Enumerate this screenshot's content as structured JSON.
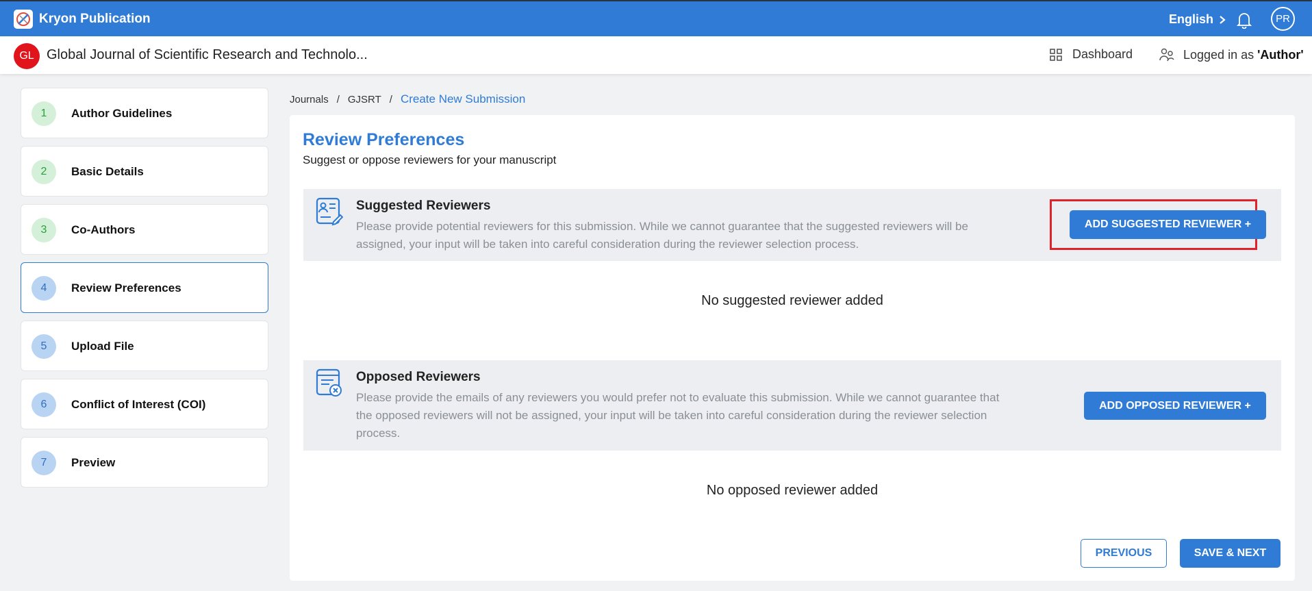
{
  "app": {
    "title": "Kryon Publication",
    "accent": "#2f7bd6"
  },
  "header": {
    "language": "English",
    "avatar_initials": "PR"
  },
  "journal": {
    "badge": "GL",
    "title": "Global Journal of Scientific Research and Technolo...",
    "dashboard_label": "Dashboard",
    "logged_prefix": "Logged in as",
    "logged_role": "'Author'"
  },
  "steps": [
    {
      "num": "1",
      "label": "Author Guidelines"
    },
    {
      "num": "2",
      "label": "Basic Details"
    },
    {
      "num": "3",
      "label": "Co-Authors"
    },
    {
      "num": "4",
      "label": "Review Preferences"
    },
    {
      "num": "5",
      "label": "Upload File"
    },
    {
      "num": "6",
      "label": "Conflict of Interest (COI)"
    },
    {
      "num": "7",
      "label": "Preview"
    }
  ],
  "breadcrumb": {
    "journals": "Journals",
    "sep": "/",
    "journal_code": "GJSRT",
    "current": "Create New Submission"
  },
  "page": {
    "title": "Review Preferences",
    "subtitle": "Suggest or oppose reviewers for your manuscript"
  },
  "suggested": {
    "title": "Suggested Reviewers",
    "description": "Please provide potential reviewers for this submission. While we cannot guarantee that the suggested reviewers will be assigned, your input will be taken into careful consideration during the reviewer selection process.",
    "button": "ADD SUGGESTED REVIEWER +",
    "empty": "No suggested reviewer added"
  },
  "opposed": {
    "title": "Opposed Reviewers",
    "description": "Please provide the emails of any reviewers you would prefer not to evaluate this submission. While we cannot guarantee that the opposed reviewers will not be assigned, your input will be taken into careful consideration during the reviewer selection process.",
    "button": "ADD OPPOSED REVIEWER +",
    "empty": "No opposed reviewer added"
  },
  "nav": {
    "previous": "PREVIOUS",
    "save_next": "SAVE & NEXT"
  }
}
